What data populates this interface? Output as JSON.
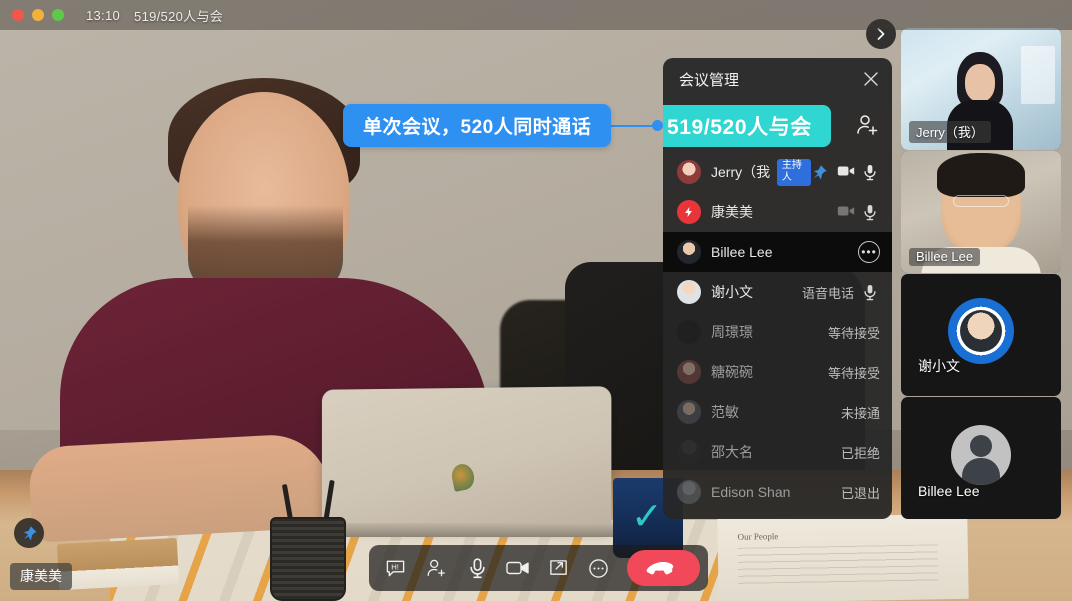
{
  "window": {
    "time": "13:10",
    "title": "519/520人与会",
    "traffic_lights": [
      "close-red",
      "minimize-yellow",
      "zoom-green"
    ]
  },
  "callout": {
    "text": "单次会议，520人同时通话",
    "color": "#2e90f0"
  },
  "collapse_button": {
    "icon": "chevron-right-icon"
  },
  "self_view": {
    "pin_icon": "pin-icon",
    "name": "康美美"
  },
  "panel": {
    "title": "会议管理",
    "close_icon": "close-icon",
    "count_badge": {
      "text": "519/520人与会",
      "color": "#2fd6d2"
    },
    "add_person_icon": "add-person-icon",
    "participants": [
      {
        "name": "Jerry（我）",
        "tag": "主持人",
        "status": "",
        "icons": [
          "pin-icon",
          "camera-icon",
          "mic-icon"
        ],
        "avatar": "av-1",
        "state": "active"
      },
      {
        "name": "康美美",
        "tag": "",
        "status": "",
        "icons": [
          "camera-icon",
          "mic-icon"
        ],
        "avatar": "av-2",
        "state": "normal"
      },
      {
        "name": "Billee Lee",
        "tag": "",
        "status": "",
        "icons": [
          "more-icon"
        ],
        "avatar": "av-3",
        "state": "hover"
      },
      {
        "name": "谢小文",
        "tag": "",
        "status": "语音电话",
        "icons": [
          "mic-icon"
        ],
        "avatar": "av-4",
        "state": "normal"
      },
      {
        "name": "周璟璟",
        "tag": "",
        "status": "等待接受",
        "icons": [],
        "avatar": "av-5",
        "state": "pending"
      },
      {
        "name": "糖碗碗",
        "tag": "",
        "status": "等待接受",
        "icons": [],
        "avatar": "av-6",
        "state": "pending"
      },
      {
        "name": "范敏",
        "tag": "",
        "status": "未接通",
        "icons": [],
        "avatar": "av-7",
        "state": "pending"
      },
      {
        "name": "邵大名",
        "tag": "",
        "status": "已拒绝",
        "icons": [],
        "avatar": "av-8",
        "state": "pending"
      },
      {
        "name": "Edison Shan",
        "tag": "",
        "status": "已退出",
        "icons": [],
        "avatar": "av-9",
        "state": "pending"
      }
    ]
  },
  "sidebar": {
    "tiles": [
      {
        "label": "Jerry（我）",
        "type": "video",
        "active": false
      },
      {
        "label": "Billee Lee",
        "type": "video",
        "active": true
      },
      {
        "label": "谢小文",
        "type": "avatar-ring",
        "active": false
      },
      {
        "label": "Billee Lee",
        "type": "avatar-gray",
        "active": false
      }
    ]
  },
  "toolbar": {
    "buttons": [
      {
        "name": "chat-icon",
        "label": "聊天"
      },
      {
        "name": "add-person-icon",
        "label": "邀请"
      },
      {
        "name": "mic-icon",
        "label": "静音"
      },
      {
        "name": "camera-icon",
        "label": "摄像头"
      },
      {
        "name": "share-screen-icon",
        "label": "共享屏幕"
      },
      {
        "name": "more-icon",
        "label": "更多"
      }
    ],
    "hangup": {
      "name": "hangup-icon",
      "label": "挂断",
      "color": "#f2495a"
    }
  },
  "paper": {
    "heading": "Our People"
  }
}
